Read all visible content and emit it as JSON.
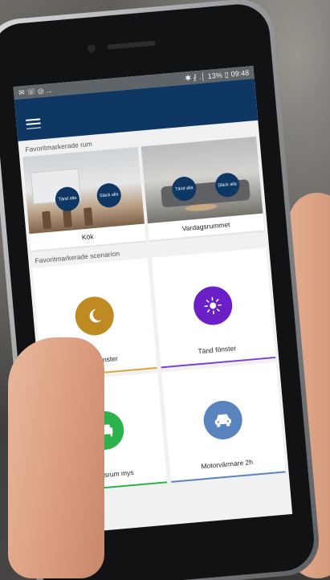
{
  "statusbar": {
    "notifications": "✉ ☏ ◎ ...",
    "icons": "✱ ⨏ .│",
    "battery": "13%",
    "time": "09:48"
  },
  "sections": {
    "rooms_title": "Favoritmarkerade rum",
    "scenarios_title": "Favoritmarkerade scenarion"
  },
  "rooms": [
    {
      "name": "Kök",
      "on_label": "Tänd alla",
      "off_label": "Släck alla"
    },
    {
      "name": "Vardagsrummet",
      "on_label": "Tänd alla",
      "off_label": "Släck alla"
    }
  ],
  "scenarios": [
    {
      "label": "Släck fönster",
      "icon": "moon-icon",
      "color": "#c08a22",
      "underline": "#d4a93c"
    },
    {
      "label": "Tänd fönster",
      "icon": "sun-icon",
      "color": "#6a1fc7",
      "underline": "#7a3fd6"
    },
    {
      "label": "Vardagsrum mys",
      "icon": "sofa-icon",
      "color": "#2bb24c",
      "underline": "#2bb24c"
    },
    {
      "label": "Motorvärmare 2h",
      "icon": "car-icon",
      "color": "#5a84bd",
      "underline": "#5a84bd"
    }
  ],
  "colors": {
    "appbar": "#0e3763",
    "statusbar": "#5f6469",
    "background": "#f1f1f1"
  }
}
